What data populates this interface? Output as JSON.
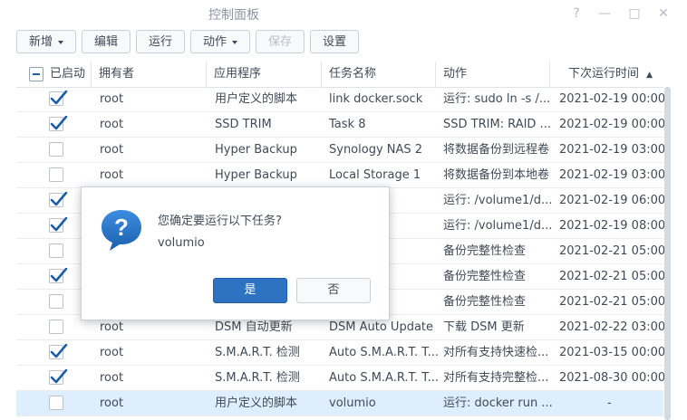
{
  "window": {
    "title": "控制面板",
    "controls": [
      "?",
      "—",
      "□",
      "✕"
    ]
  },
  "toolbar": {
    "new_label": "新增",
    "edit_label": "编辑",
    "run_label": "运行",
    "action_label": "动作",
    "save_label": "保存",
    "settings_label": "设置"
  },
  "table": {
    "headers": {
      "enabled": "已启动",
      "owner": "拥有者",
      "app": "应用程序",
      "task": "任务名称",
      "action": "动作",
      "next_run": "下次运行时间"
    },
    "rows": [
      {
        "enabled": true,
        "owner": "root",
        "app": "用户定义的脚本",
        "task": "link docker.sock",
        "action": "运行: sudo ln -s /...",
        "next_run": "2021-02-19 00:00"
      },
      {
        "enabled": true,
        "owner": "root",
        "app": "SSD TRIM",
        "task": "Task 8",
        "action": "SSD TRIM: RAID ...",
        "next_run": "2021-02-19 00:00"
      },
      {
        "enabled": false,
        "owner": "root",
        "app": "Hyper Backup",
        "task": "Synology NAS 2",
        "action": "将数据备份到远程卷",
        "next_run": "2021-02-19 03:00"
      },
      {
        "enabled": false,
        "owner": "root",
        "app": "Hyper Backup",
        "task": "Local Storage 1",
        "action": "将数据备份到本地卷",
        "next_run": "2021-02-19 03:00"
      },
      {
        "enabled": true,
        "owner": "",
        "app": "",
        "task": "",
        "action": "运行: /volume1/d...",
        "next_run": "2021-02-19 06:00"
      },
      {
        "enabled": true,
        "owner": "",
        "app": "",
        "task": "kup",
        "action": "运行: /volume1/d...",
        "next_run": "2021-02-19 08:00"
      },
      {
        "enabled": false,
        "owner": "",
        "app": "",
        "task": "AS 2",
        "action": "备份完整性检查",
        "next_run": "2021-02-21 05:00"
      },
      {
        "enabled": true,
        "owner": "",
        "app": "",
        "task": "ge 2",
        "action": "备份完整性检查",
        "next_run": "2021-02-21 05:00"
      },
      {
        "enabled": false,
        "owner": "",
        "app": "",
        "task": "ge 1",
        "action": "备份完整性检查",
        "next_run": "2021-02-21 05:00"
      },
      {
        "enabled": false,
        "owner": "root",
        "app": "DSM 自动更新",
        "task": "DSM Auto Update",
        "action": "下载 DSM 更新",
        "next_run": "2021-02-22 03:00"
      },
      {
        "enabled": true,
        "owner": "root",
        "app": "S.M.A.R.T. 检测",
        "task": "Auto S.M.A.R.T. T...",
        "action": "对所有支持快速检...",
        "next_run": "2021-03-15 00:00"
      },
      {
        "enabled": true,
        "owner": "root",
        "app": "S.M.A.R.T. 检测",
        "task": "Auto S.M.A.R.T. T...",
        "action": "对所有支持完整检...",
        "next_run": "2021-08-30 00:00"
      },
      {
        "enabled": false,
        "owner": "root",
        "app": "用户定义的脚本",
        "task": "volumio",
        "action": "运行: docker run ...",
        "next_run": "-"
      }
    ]
  },
  "dialog": {
    "message": "您确定要运行以下任务?",
    "task_name": "volumio",
    "yes_label": "是",
    "no_label": "否"
  },
  "colors": {
    "accent": "#2e73c2",
    "checkbox_mark": "#1e5ea7",
    "selected_row": "#dfeefd"
  }
}
